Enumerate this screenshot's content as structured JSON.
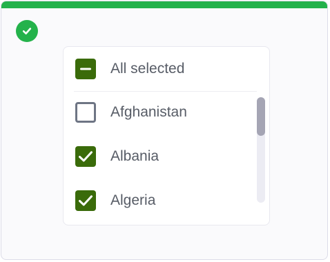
{
  "theme": {
    "success_color": "#24b24b",
    "checkbox_checked_color": "#3a6b0a",
    "checkbox_unchecked_border": "#6e7584"
  },
  "status": {
    "icon": "check-circle-icon"
  },
  "select_all": {
    "label": "All selected",
    "state": "indeterminate"
  },
  "items": [
    {
      "label": "Afghanistan",
      "checked": false
    },
    {
      "label": "Albania",
      "checked": true
    },
    {
      "label": "Algeria",
      "checked": true
    }
  ]
}
